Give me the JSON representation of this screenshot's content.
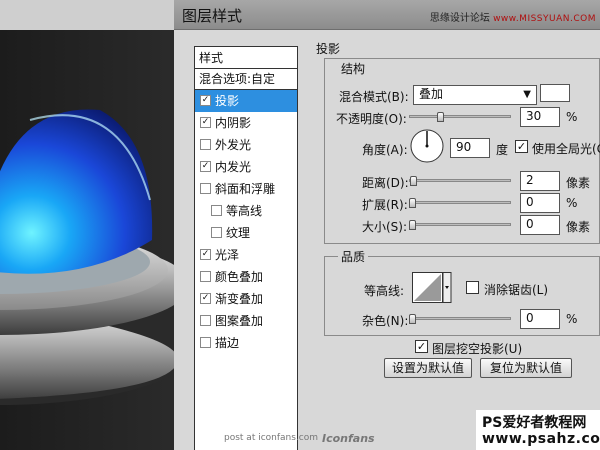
{
  "dialog": {
    "title": "图层样式",
    "site_tag_cn": "思缘设计论坛",
    "site_tag_url": "www.MISSYUAN.COM"
  },
  "style_list": {
    "header": "样式",
    "blend_options": "混合选项:自定",
    "items": [
      {
        "label": "投影",
        "checked": true,
        "selected": true
      },
      {
        "label": "内阴影",
        "checked": true,
        "selected": false
      },
      {
        "label": "外发光",
        "checked": false,
        "selected": false
      },
      {
        "label": "内发光",
        "checked": true,
        "selected": false
      },
      {
        "label": "斜面和浮雕",
        "checked": false,
        "selected": false
      },
      {
        "label": "等高线",
        "checked": false,
        "selected": false,
        "sub": true
      },
      {
        "label": "纹理",
        "checked": false,
        "selected": false,
        "sub": true
      },
      {
        "label": "光泽",
        "checked": true,
        "selected": false
      },
      {
        "label": "颜色叠加",
        "checked": false,
        "selected": false
      },
      {
        "label": "渐变叠加",
        "checked": true,
        "selected": false
      },
      {
        "label": "图案叠加",
        "checked": false,
        "selected": false
      },
      {
        "label": "描边",
        "checked": false,
        "selected": false
      }
    ]
  },
  "drop_shadow": {
    "section_title": "投影",
    "structure_title": "结构",
    "blend_mode_label": "混合模式(B):",
    "blend_mode_value": "叠加",
    "shadow_color": "#ffffff",
    "opacity_label": "不透明度(O):",
    "opacity_value": "30",
    "opacity_unit": "%",
    "opacity_fraction": 0.3,
    "angle_label": "角度(A):",
    "angle_value": "90",
    "angle_unit": "度",
    "global_light_label": "使用全局光(G",
    "global_light_checked": true,
    "distance_label": "距离(D):",
    "distance_value": "2",
    "distance_unit": "像素",
    "spread_label": "扩展(R):",
    "spread_value": "0",
    "spread_unit": "%",
    "size_label": "大小(S):",
    "size_value": "0",
    "size_unit": "像素",
    "quality_title": "品质",
    "contour_label": "等高线:",
    "antialias_label": "消除锯齿(L)",
    "antialias_checked": false,
    "noise_label": "杂色(N):",
    "noise_value": "0",
    "noise_unit": "%",
    "knockout_label": "图层挖空投影(U)",
    "knockout_checked": true,
    "make_default_button": "设置为默认值",
    "reset_default_button": "复位为默认值"
  },
  "watermarks": {
    "bottom": "post at iconfans.com",
    "bottom_logo": "Iconfans",
    "brand_line1": "PS爱好者教程网",
    "brand_line2": "www.psahz.com"
  },
  "colors": {
    "selection": "#2d8fe0",
    "dialog_bg": "#d8d8d8",
    "dome_blue": "#1a6cf0"
  }
}
